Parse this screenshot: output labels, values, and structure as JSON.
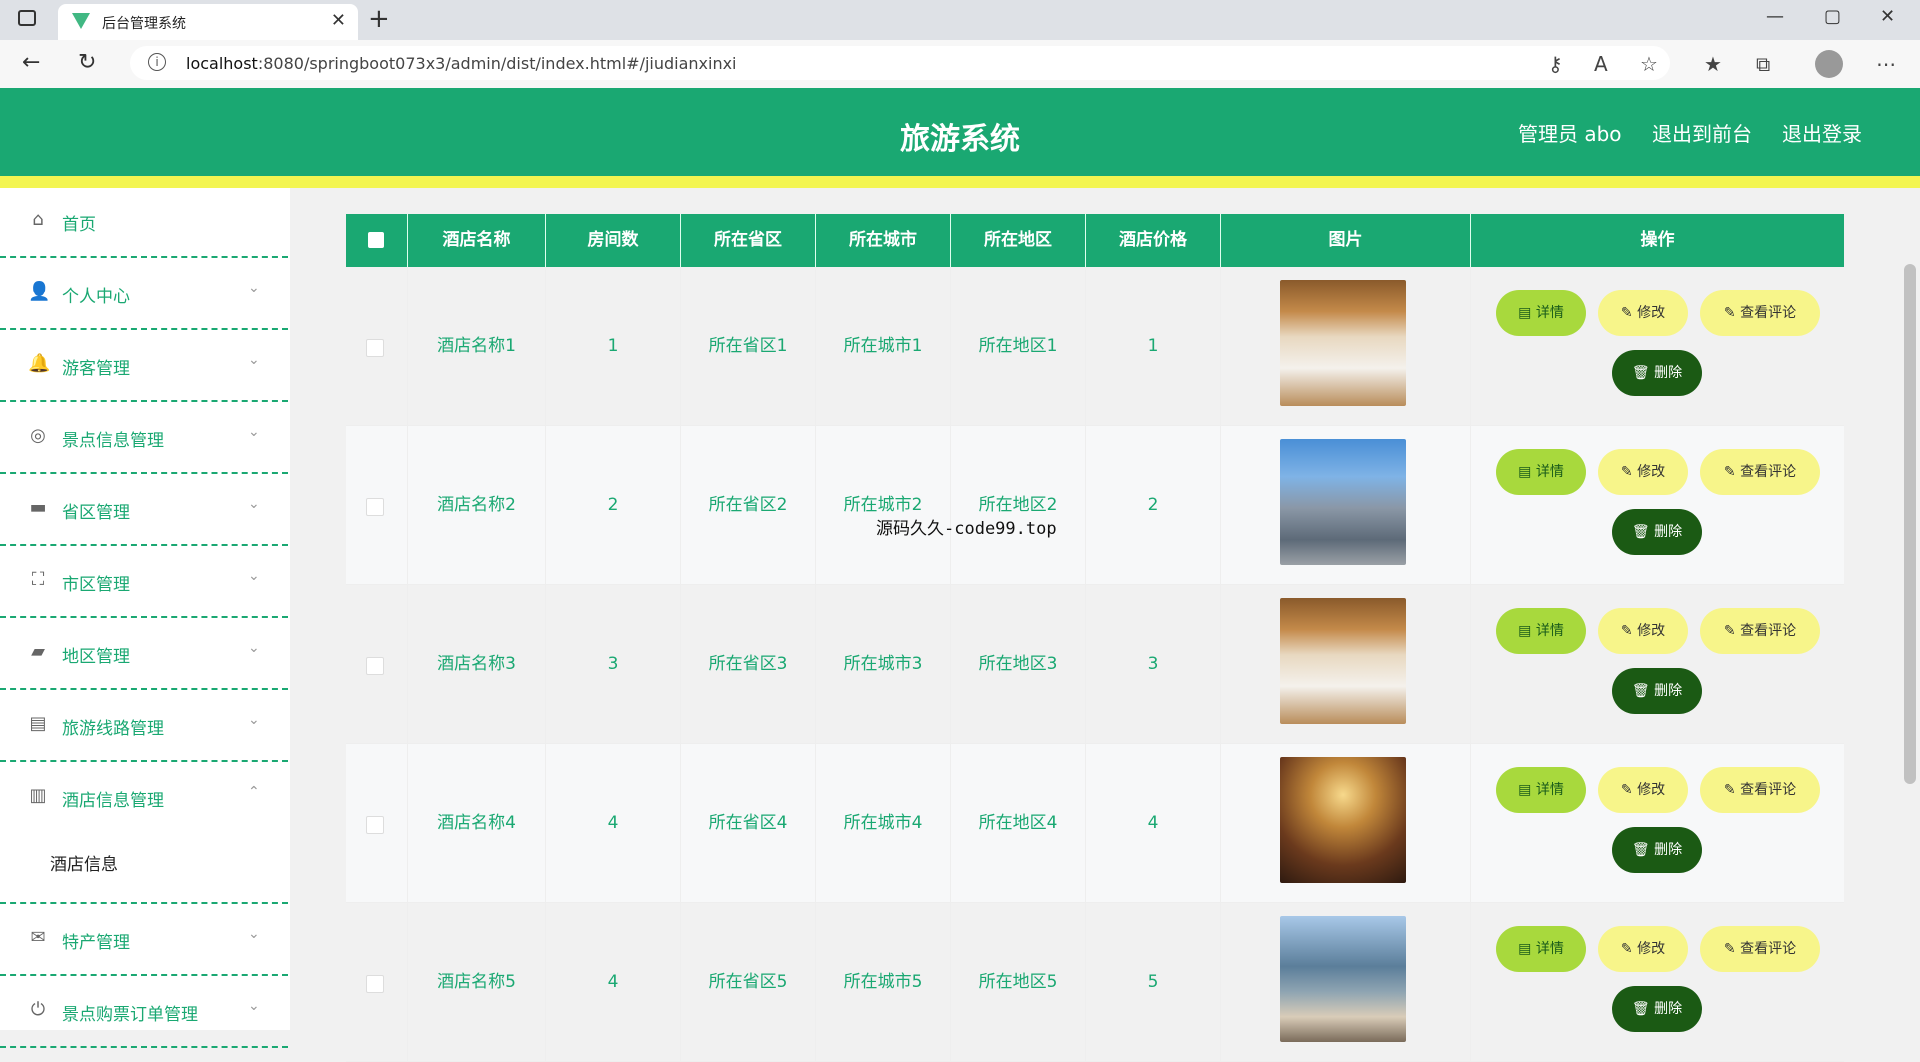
{
  "browser": {
    "tab_title": "后台管理系统",
    "tab_close": "✕",
    "new_tab": "+",
    "url_host": "localhost",
    "url_path": ":8080/springboot073x3/admin/dist/index.html#/jiudianxinxi",
    "info_icon": "i",
    "minimize": "—",
    "maximize": "▢",
    "close": "✕",
    "back": "←",
    "reload": "↻"
  },
  "app": {
    "title": "旅游系统",
    "user_label": "管理员 abo",
    "to_front": "退出到前台",
    "logout": "退出登录"
  },
  "sidebar": {
    "items": [
      {
        "label": "首页",
        "icon": "home-icon",
        "glyph": "⌂",
        "arrow": ""
      },
      {
        "label": "个人中心",
        "icon": "user-icon",
        "glyph": "👤",
        "arrow": "⌄"
      },
      {
        "label": "游客管理",
        "icon": "bell-icon",
        "glyph": "🔔",
        "arrow": "⌄"
      },
      {
        "label": "景点信息管理",
        "icon": "compass-icon",
        "glyph": "◎",
        "arrow": "⌄"
      },
      {
        "label": "省区管理",
        "icon": "chat-icon",
        "glyph": "▬",
        "arrow": "⌄"
      },
      {
        "label": "市区管理",
        "icon": "crop-icon",
        "glyph": "⛶",
        "arrow": "⌄"
      },
      {
        "label": "地区管理",
        "icon": "briefcase-icon",
        "glyph": "▰",
        "arrow": "⌄"
      },
      {
        "label": "旅游线路管理",
        "icon": "printer-icon",
        "glyph": "▤",
        "arrow": "⌄"
      },
      {
        "label": "酒店信息管理",
        "icon": "clipboard-icon",
        "glyph": "▥",
        "arrow": "⌃"
      },
      {
        "label": "特产管理",
        "icon": "mail-icon",
        "glyph": "✉",
        "arrow": "⌄"
      },
      {
        "label": "景点购票订单管理",
        "icon": "power-icon",
        "glyph": "⏻",
        "arrow": "⌄"
      }
    ],
    "submenu_label": "酒店信息"
  },
  "table": {
    "columns": [
      "",
      "酒店名称",
      "房间数",
      "所在省区",
      "所在城市",
      "所在地区",
      "酒店价格",
      "图片",
      "操作"
    ],
    "rows": [
      {
        "name": "酒店名称1",
        "rooms": "1",
        "province": "所在省区1",
        "city": "所在城市1",
        "area": "所在地区1",
        "price": "1",
        "image": "bedroom"
      },
      {
        "name": "酒店名称2",
        "rooms": "2",
        "province": "所在省区2",
        "city": "所在城市2",
        "area": "所在地区2",
        "price": "2",
        "image": "building"
      },
      {
        "name": "酒店名称3",
        "rooms": "3",
        "province": "所在省区3",
        "city": "所在城市3",
        "area": "所在地区3",
        "price": "3",
        "image": "bedroom"
      },
      {
        "name": "酒店名称4",
        "rooms": "4",
        "province": "所在省区4",
        "city": "所在城市4",
        "area": "所在地区4",
        "price": "4",
        "image": "ballroom"
      },
      {
        "name": "酒店名称5",
        "rooms": "4",
        "province": "所在省区5",
        "city": "所在城市5",
        "area": "所在地区5",
        "price": "5",
        "image": "resort"
      }
    ],
    "actions": {
      "detail": "详情",
      "edit": "修改",
      "comment": "查看评论",
      "delete": "删除"
    }
  },
  "overlay": "源码久久-code99.top",
  "colors": {
    "primary": "#1aa872",
    "accent_yellow": "#f3f551",
    "detail_btn": "#a8d93d",
    "delete_btn": "#1b5a14"
  }
}
